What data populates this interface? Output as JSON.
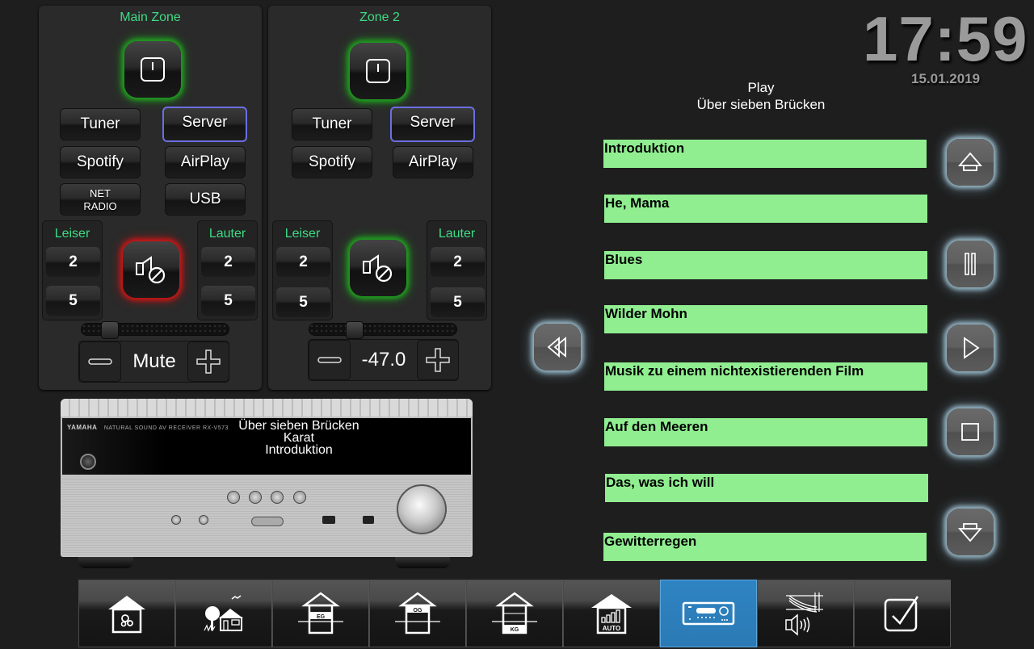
{
  "zones": [
    {
      "title": "Main Zone",
      "power_state": "on",
      "sources": [
        {
          "label": "Tuner",
          "active": false
        },
        {
          "label": "Server",
          "active": true
        },
        {
          "label": "Spotify",
          "active": false
        },
        {
          "label": "AirPlay",
          "active": false
        },
        {
          "label": "NET RADIO",
          "label_line1": "NET",
          "label_line2": "RADIO",
          "active": false
        },
        {
          "label": "USB",
          "active": false
        }
      ],
      "volume_down": {
        "label": "Leiser",
        "steps": [
          "2",
          "5"
        ]
      },
      "volume_up": {
        "label": "Lauter",
        "steps": [
          "2",
          "5"
        ]
      },
      "mute_state": "muted",
      "volume_slider_fraction": 0.15,
      "volume_display": "Mute"
    },
    {
      "title": "Zone 2",
      "power_state": "on",
      "sources": [
        {
          "label": "Tuner",
          "active": false
        },
        {
          "label": "Server",
          "active": true
        },
        {
          "label": "Spotify",
          "active": false
        },
        {
          "label": "AirPlay",
          "active": false
        }
      ],
      "volume_down": {
        "label": "Leiser",
        "steps": [
          "2",
          "5"
        ]
      },
      "volume_up": {
        "label": "Lauter",
        "steps": [
          "2",
          "5"
        ]
      },
      "mute_state": "unmuted",
      "volume_slider_fraction": 0.28,
      "volume_display": "-47.0"
    }
  ],
  "receiver": {
    "brand": "YAMAHA",
    "model_text": "NATURAL SOUND AV RECEIVER  RX-V573",
    "display_lines": [
      "Über sieben Brücken",
      "Karat",
      "Introduktion"
    ]
  },
  "now_playing": {
    "status": "Play",
    "album": "Über sieben Brücken"
  },
  "tracks": [
    "Introduktion",
    "He, Mama",
    "Blues",
    "Wilder Mohn",
    "Musik zu einem nichtexistierenden Film",
    "Auf den Meeren",
    "Das, was ich will",
    "Gewitterregen"
  ],
  "controls": {
    "previous": "previous-icon",
    "scroll_up": "scroll-up-icon",
    "pause": "pause-icon",
    "play": "play-icon",
    "stop": "stop-icon",
    "scroll_down": "scroll-down-icon"
  },
  "clock": {
    "time": "17:59",
    "date": "15.01.2019"
  },
  "nav": [
    {
      "name": "house-settings",
      "badge": "",
      "active": false
    },
    {
      "name": "garden",
      "badge": "",
      "active": false
    },
    {
      "name": "floor-eg",
      "badge": "EG",
      "active": false
    },
    {
      "name": "floor-og",
      "badge": "OG",
      "active": false
    },
    {
      "name": "floor-kg",
      "badge": "KG",
      "active": false
    },
    {
      "name": "automation",
      "badge": "AUTO",
      "active": false
    },
    {
      "name": "receiver",
      "badge": "",
      "active": true
    },
    {
      "name": "audio-network",
      "badge": "",
      "active": false
    },
    {
      "name": "tasks",
      "badge": "",
      "active": false
    }
  ],
  "colors": {
    "accent_green": "#3ddc84",
    "track_bg": "#90ee90",
    "active_tab": "#2b7ab5",
    "active_source_border": "#6b6fe0",
    "power_glow": "#1fa31f",
    "mute_glow": "#d01515"
  }
}
